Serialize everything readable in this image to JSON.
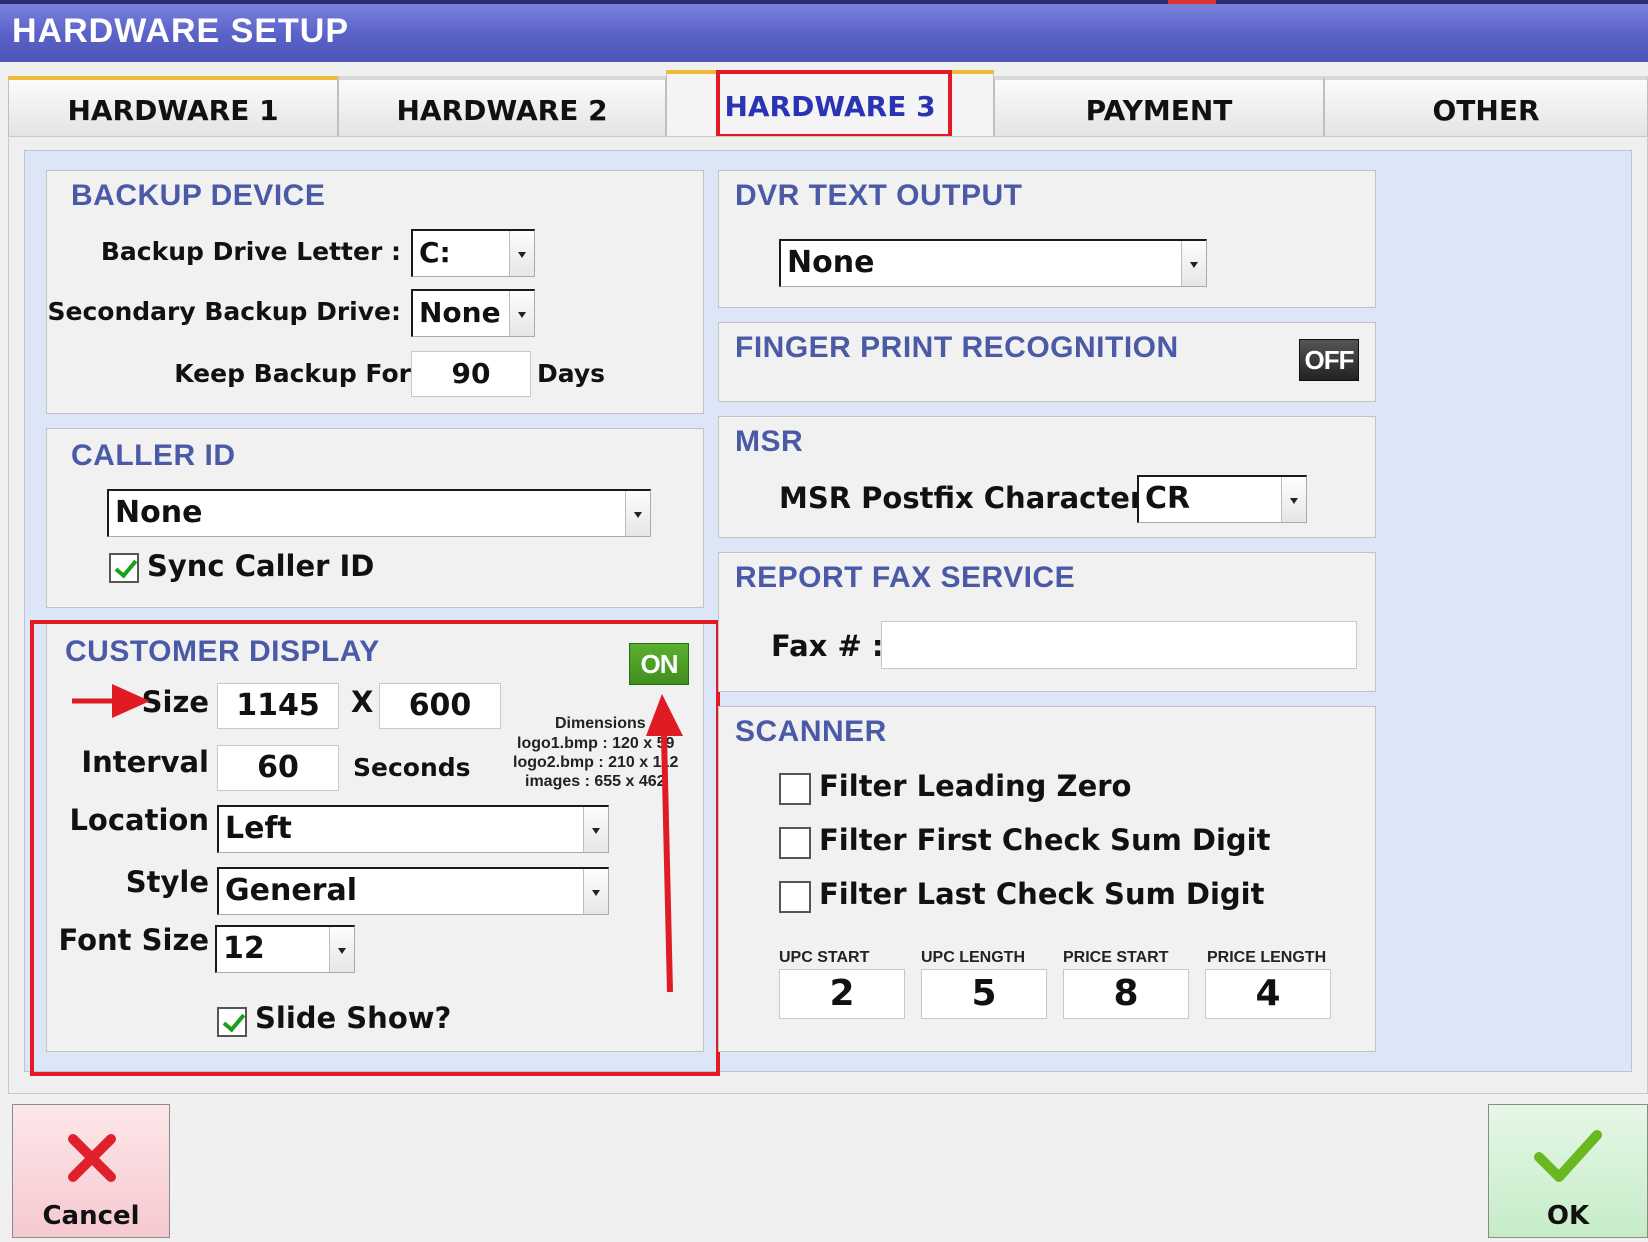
{
  "window": {
    "title": "HARDWARE SETUP"
  },
  "tabs": [
    {
      "label": "HARDWARE 1"
    },
    {
      "label": "HARDWARE 2"
    },
    {
      "label": "HARDWARE 3"
    },
    {
      "label": "PAYMENT"
    },
    {
      "label": "OTHER"
    }
  ],
  "backup": {
    "title": "BACKUP DEVICE",
    "drive_letter_label": "Backup Drive Letter :",
    "drive_letter_value": "C:",
    "secondary_label": "Secondary Backup Drive:",
    "secondary_value": "None",
    "keep_label": "Keep Backup For",
    "keep_value": "90",
    "keep_unit": "Days"
  },
  "caller_id": {
    "title": "CALLER ID",
    "value": "None",
    "sync_label": "Sync Caller ID",
    "sync_checked": true
  },
  "customer_display": {
    "title": "CUSTOMER DISPLAY",
    "toggle": "ON",
    "size_label": "Size",
    "width": "1145",
    "x_label": "X",
    "height": "600",
    "interval_label": "Interval",
    "interval_value": "60",
    "interval_unit": "Seconds",
    "dims_title": "Dimensions",
    "dims_logo1": "logo1.bmp : 120 x 59",
    "dims_logo2": "logo2.bmp : 210 x 112",
    "dims_images": "images : 655 x 462",
    "location_label": "Location",
    "location_value": "Left",
    "style_label": "Style",
    "style_value": "General",
    "font_size_label": "Font Size",
    "font_size_value": "12",
    "slideshow_label": "Slide Show?",
    "slideshow_checked": true
  },
  "dvr": {
    "title": "DVR TEXT OUTPUT",
    "value": "None"
  },
  "fingerprint": {
    "title": "FINGER PRINT RECOGNITION",
    "toggle": "OFF"
  },
  "msr": {
    "title": "MSR",
    "postfix_label": "MSR Postfix Character :",
    "postfix_value": "CR"
  },
  "fax": {
    "title": "REPORT FAX SERVICE",
    "label": "Fax # :",
    "value": ""
  },
  "scanner": {
    "title": "SCANNER",
    "filter_leading_zero": "Filter Leading Zero",
    "filter_first_checksum": "Filter First Check Sum Digit",
    "filter_last_checksum": "Filter Last Check Sum Digit",
    "upc_start_label": "UPC START",
    "upc_start": "2",
    "upc_length_label": "UPC LENGTH",
    "upc_length": "5",
    "price_start_label": "PRICE START",
    "price_start": "8",
    "price_length_label": "PRICE LENGTH",
    "price_length": "4"
  },
  "buttons": {
    "cancel": "Cancel",
    "ok": "OK"
  },
  "colors": {
    "accent": "#4a5aa6",
    "highlight": "#e01b24",
    "toggle_on": "#3f8f1f",
    "toggle_off": "#333333"
  }
}
